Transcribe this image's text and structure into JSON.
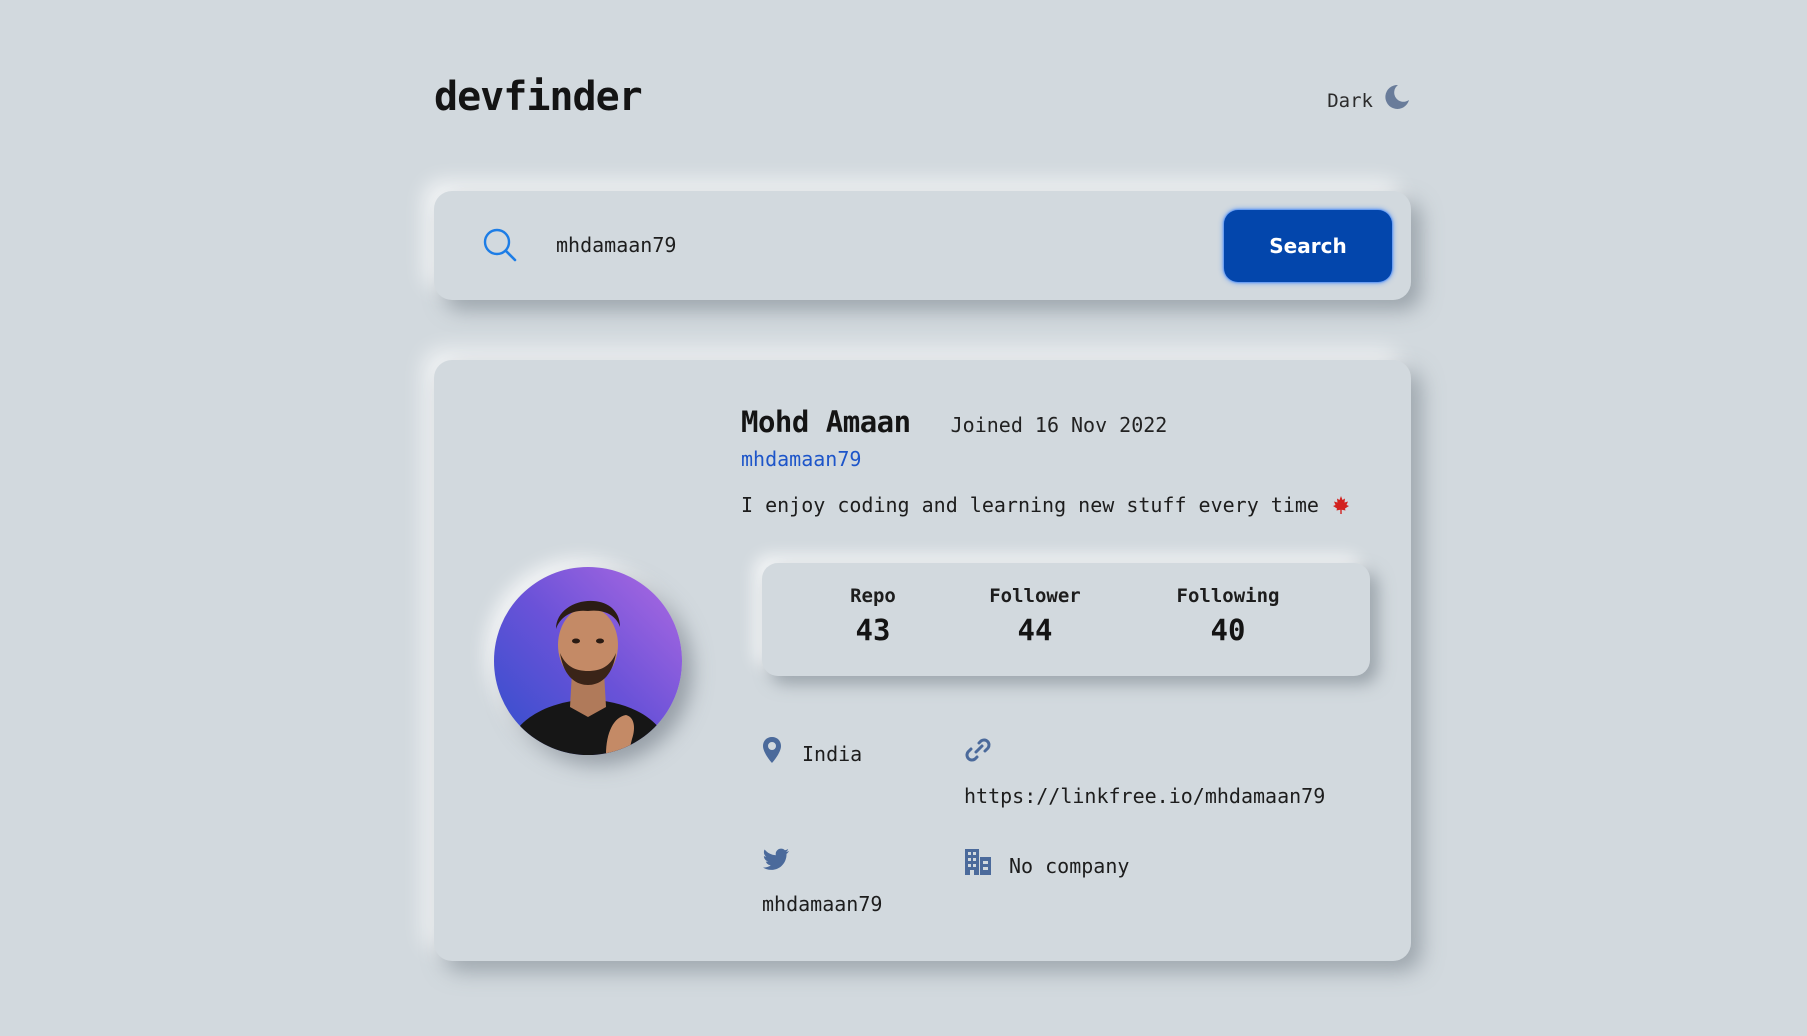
{
  "header": {
    "logo": "devfinder",
    "theme_toggle_label": "Dark"
  },
  "search": {
    "value": "mhdamaan79",
    "button_label": "Search"
  },
  "profile": {
    "name": "Mohd Amaan",
    "joined": "Joined 16 Nov 2022",
    "username": "mhdamaan79",
    "bio": "I enjoy coding and learning new stuff every time",
    "stats": [
      {
        "label": "Repo",
        "value": "43"
      },
      {
        "label": "Follower",
        "value": "44"
      },
      {
        "label": "Following",
        "value": "40"
      }
    ],
    "location": "India",
    "website": "https://linkfree.io/mhdamaan79",
    "twitter": "mhdamaan79",
    "company": "No company"
  },
  "colors": {
    "background": "#d2d9de",
    "accent": "#0346ac",
    "link": "#1d55c9",
    "icon": "#4b6a9b"
  },
  "icons": {
    "theme": "moon-icon",
    "search": "search-icon",
    "bio_emoji": "maple-leaf-icon",
    "location": "location-pin-icon",
    "website": "link-icon",
    "twitter": "twitter-icon",
    "company": "building-icon"
  }
}
